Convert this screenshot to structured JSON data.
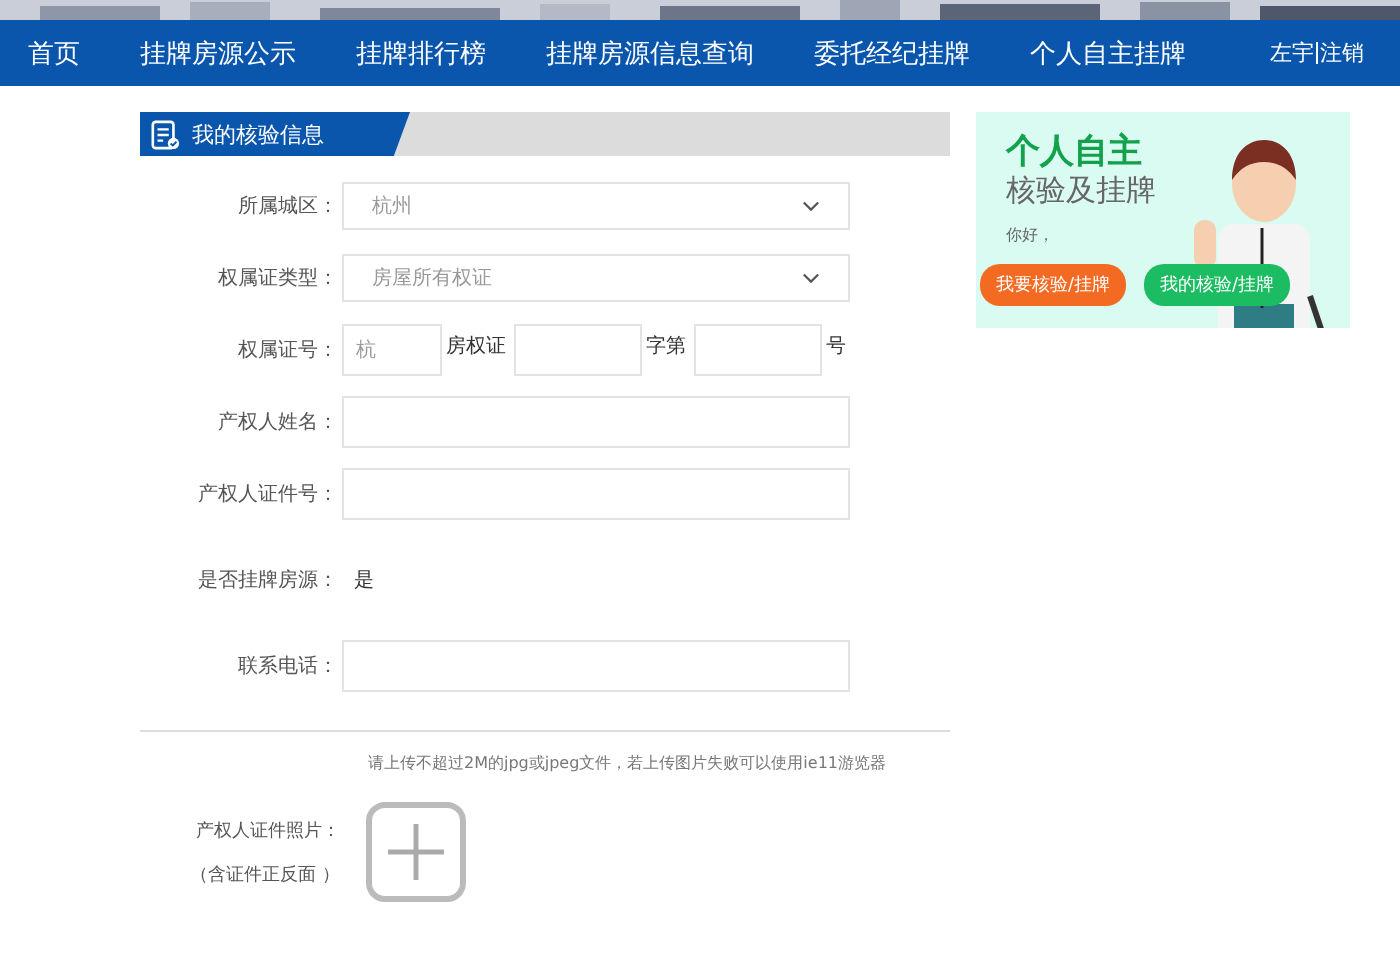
{
  "nav": {
    "items": [
      "首页",
      "挂牌房源公示",
      "挂牌排行榜",
      "挂牌房源信息查询",
      "委托经纪挂牌",
      "个人自主挂牌"
    ],
    "user": "左宇",
    "logout": "注销"
  },
  "section": {
    "title": "我的核验信息"
  },
  "form": [
    {
      "kind": "select",
      "label": "所属城区：",
      "value": "杭州"
    },
    {
      "kind": "select",
      "label": "权属证类型：",
      "value": "房屋所有权证"
    },
    {
      "kind": "cert",
      "label": "权属证号：",
      "placeholder": "杭",
      "parts": [
        "房权证",
        "字第",
        "号"
      ]
    },
    {
      "kind": "input",
      "label": "产权人姓名："
    },
    {
      "kind": "input",
      "label": "产权人证件号："
    },
    {
      "kind": "text",
      "label": "是否挂牌房源：",
      "value": "是"
    },
    {
      "kind": "input",
      "label": "联系电话："
    }
  ],
  "upload": {
    "note": "请上传不超过2M的jpg或jpeg文件，若上传图片失败可以使用ie11游览器",
    "label": "产权人证件照片：",
    "sublabel": "（含证件正反面 ）"
  },
  "promo": {
    "title": "个人自主",
    "subtitle": "核验及挂牌",
    "greeting": "你好，",
    "buttons": [
      "我要核验/挂牌",
      "我的核验/挂牌"
    ]
  }
}
